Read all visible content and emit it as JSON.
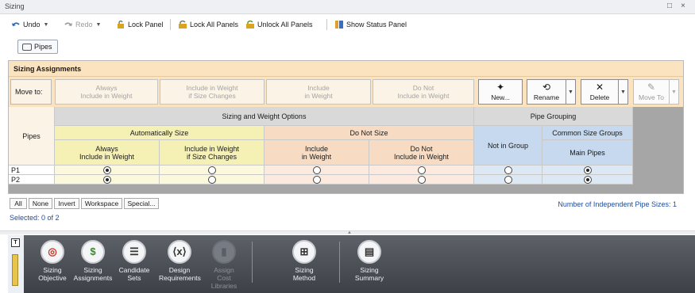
{
  "window": {
    "title": "Sizing",
    "restore_glyph": "□",
    "close_glyph": "×"
  },
  "toolbar": {
    "undo": "Undo",
    "redo": "Redo",
    "lock_panel": "Lock Panel",
    "lock_all_panels": "Lock All Panels",
    "unlock_all_panels": "Unlock All Panels",
    "show_status_panel": "Show Status Panel"
  },
  "tabs": {
    "pipes": "Pipes"
  },
  "panel": {
    "title": "Sizing Assignments",
    "move_to_label": "Move to:",
    "move_buttons": [
      {
        "line1": "Always",
        "line2": "Include in Weight"
      },
      {
        "line1": "Include in Weight",
        "line2": "if Size Changes"
      },
      {
        "line1": "Include",
        "line2": "in Weight"
      },
      {
        "line1": "Do Not",
        "line2": "Include in Weight"
      }
    ],
    "actions": {
      "new": "New...",
      "rename": "Rename",
      "delete": "Delete",
      "move_to": "Move To"
    }
  },
  "grid": {
    "pipes_header": "Pipes",
    "options_header": "Sizing and Weight Options",
    "auto_size": "Automatically Size",
    "do_not_size": "Do Not Size",
    "grouping_header": "Pipe Grouping",
    "not_in_group": "Not in Group",
    "common_groups": "Common Size Groups",
    "main_pipes": "Main Pipes",
    "columns": [
      {
        "line1": "Always",
        "line2": "Include in Weight"
      },
      {
        "line1": "Include in Weight",
        "line2": "if Size Changes"
      },
      {
        "line1": "Include",
        "line2": "in Weight"
      },
      {
        "line1": "Do Not",
        "line2": "Include in Weight"
      }
    ],
    "rows": [
      {
        "name": "P1",
        "option": 0,
        "group": "main"
      },
      {
        "name": "P2",
        "option": 0,
        "group": "main"
      }
    ]
  },
  "footer": {
    "buttons": [
      "All",
      "None",
      "Invert",
      "Workspace",
      "Special..."
    ],
    "selected": "Selected: 0 of 2",
    "independent_sizes": "Number of Independent Pipe Sizes: 1"
  },
  "dock": {
    "items": [
      {
        "label1": "Sizing",
        "label2": "Objective",
        "icon": "target-icon",
        "enabled": true
      },
      {
        "label1": "Sizing",
        "label2": "Assignments",
        "icon": "pencil-dollar-icon",
        "enabled": true
      },
      {
        "label1": "Candidate",
        "label2": "Sets",
        "icon": "list-icon",
        "enabled": true
      },
      {
        "label1": "Design",
        "label2": "Requirements",
        "icon": "variable-x-icon",
        "enabled": true
      },
      {
        "label1": "Assign",
        "label2": "Cost Libraries",
        "icon": "cost-library-icon",
        "enabled": false
      },
      {
        "label1": "Sizing",
        "label2": "Method",
        "icon": "flowchart-icon",
        "enabled": true
      },
      {
        "label1": "Sizing",
        "label2": "Summary",
        "icon": "summary-icon",
        "enabled": true
      }
    ]
  },
  "colors": {
    "header_orange": "#fce3bf",
    "auto_size_yellow": "#f5f0b4",
    "do_not_size_peach": "#f7dcc3",
    "pipe_grouping_blue": "#c6d9ef",
    "link_blue": "#1f4da0"
  }
}
